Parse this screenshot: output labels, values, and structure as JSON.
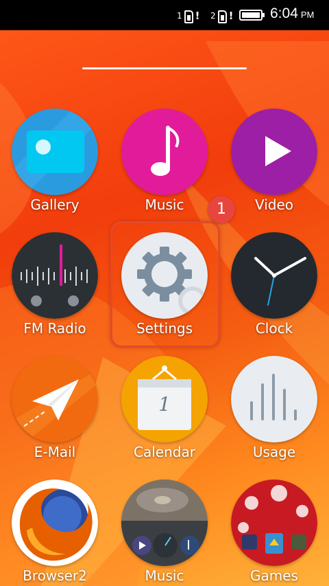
{
  "status_bar": {
    "sim1_label": "1",
    "sim2_label": "2",
    "sim_alert": "!",
    "time": "6:04",
    "ampm": "PM",
    "battery_level": 1.0
  },
  "notification_badge": {
    "count": "1"
  },
  "apps": [
    {
      "label": "Gallery",
      "icon": "gallery-icon"
    },
    {
      "label": "Music",
      "icon": "music-note-icon"
    },
    {
      "label": "Video",
      "icon": "play-icon"
    },
    {
      "label": "FM Radio",
      "icon": "radio-dial-icon"
    },
    {
      "label": "Settings",
      "icon": "gear-icon"
    },
    {
      "label": "Clock",
      "icon": "clock-icon"
    },
    {
      "label": "E-Mail",
      "icon": "paper-plane-icon"
    },
    {
      "label": "Calendar",
      "icon": "calendar-icon",
      "day": "1"
    },
    {
      "label": "Usage",
      "icon": "usage-bars-icon"
    },
    {
      "label": "Browser2",
      "icon": "firefox-icon"
    },
    {
      "label": "Music",
      "icon": "turntable-icon"
    },
    {
      "label": "Games",
      "icon": "games-icon"
    }
  ],
  "colors": {
    "gallery": "#2b9be0",
    "music": "#e21b9b",
    "video": "#9c1fa5",
    "fm_radio": "#2b3035",
    "settings": "#e8ecf0",
    "clock": "#23292f",
    "email": "#f26a10",
    "calendar": "#f5a300",
    "usage": "#e9edf1",
    "badge": "#e8453f"
  }
}
